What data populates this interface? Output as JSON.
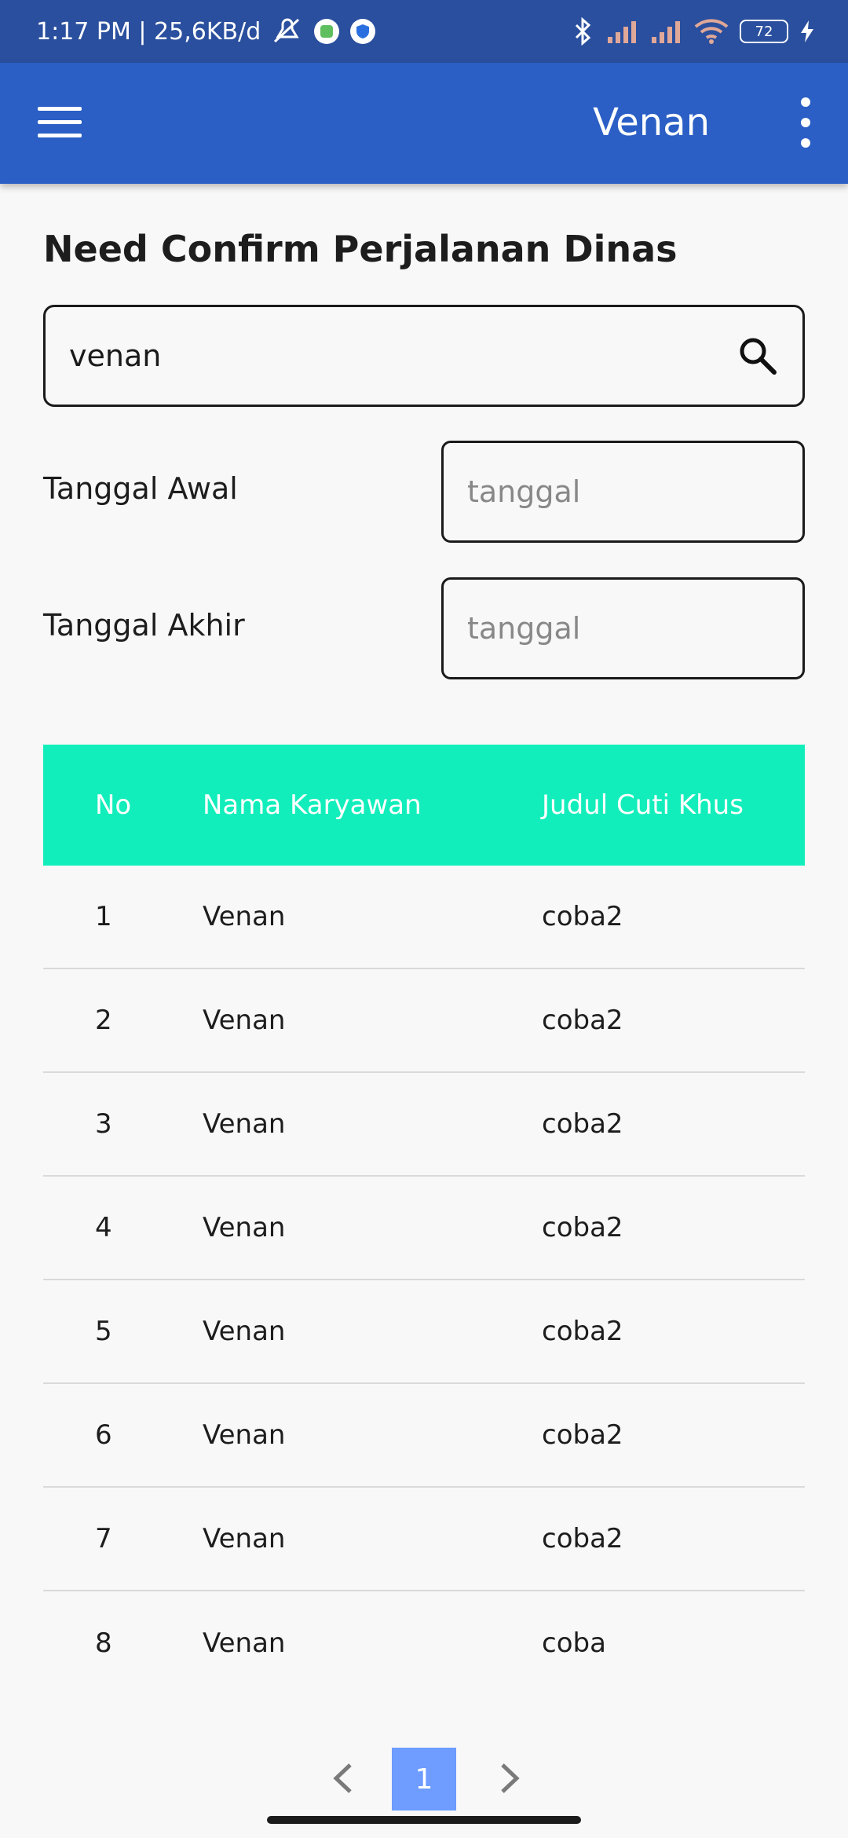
{
  "status_bar": {
    "time_and_speed": "1:17 PM | 25,6KB/d",
    "battery": "72"
  },
  "app_bar": {
    "title": "Venan"
  },
  "page": {
    "title": "Need Confirm Perjalanan Dinas"
  },
  "search": {
    "value": "venan"
  },
  "filters": {
    "start_label": "Tanggal Awal",
    "end_label": "Tanggal Akhir",
    "date_placeholder": "tanggal"
  },
  "table": {
    "headers": [
      "No",
      "Nama Karyawan",
      "Judul Cuti Khus"
    ],
    "rows": [
      [
        "1",
        "Venan",
        "coba2"
      ],
      [
        "2",
        "Venan",
        "coba2"
      ],
      [
        "3",
        "Venan",
        "coba2"
      ],
      [
        "4",
        "Venan",
        "coba2"
      ],
      [
        "5",
        "Venan",
        "coba2"
      ],
      [
        "6",
        "Venan",
        "coba2"
      ],
      [
        "7",
        "Venan",
        "coba2"
      ],
      [
        "8",
        "Venan",
        "coba"
      ]
    ]
  },
  "pagination": {
    "current_page": "1"
  },
  "colors": {
    "status_bar": "#2a4f9e",
    "app_bar": "#2b5fc6",
    "table_header": "#12eebb",
    "page_active": "#6e9cff"
  }
}
